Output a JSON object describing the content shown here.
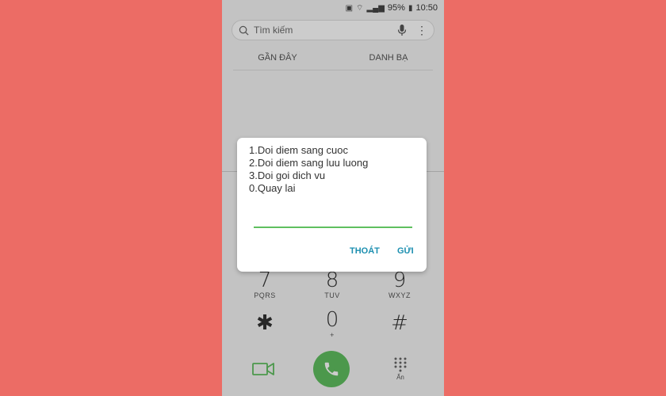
{
  "status": {
    "battery": "95%",
    "time": "10:50"
  },
  "search": {
    "placeholder": "Tìm kiếm"
  },
  "tabs": [
    {
      "label": "GẦN ĐÂY"
    },
    {
      "label": "DANH BẠ"
    }
  ],
  "keypad": [
    {
      "num": "7",
      "sub": "PQRS"
    },
    {
      "num": "8",
      "sub": "TUV"
    },
    {
      "num": "9",
      "sub": "WXYZ"
    },
    {
      "num": "✱",
      "sub": ""
    },
    {
      "num": "0",
      "sub": "+"
    },
    {
      "num": "#",
      "sub": ""
    }
  ],
  "bottom": {
    "hide_label": "Ẩn"
  },
  "dialog": {
    "lines": [
      "1.Doi diem sang cuoc",
      "2.Doi diem sang luu luong",
      "3.Doi goi dich vu",
      "0.Quay lai"
    ],
    "input_value": "",
    "cancel_label": "THOÁT",
    "send_label": "GỬI"
  },
  "colors": {
    "background": "#ec6c65",
    "accent_green": "#5fbf5f",
    "button_blue": "#1c8fb0"
  }
}
